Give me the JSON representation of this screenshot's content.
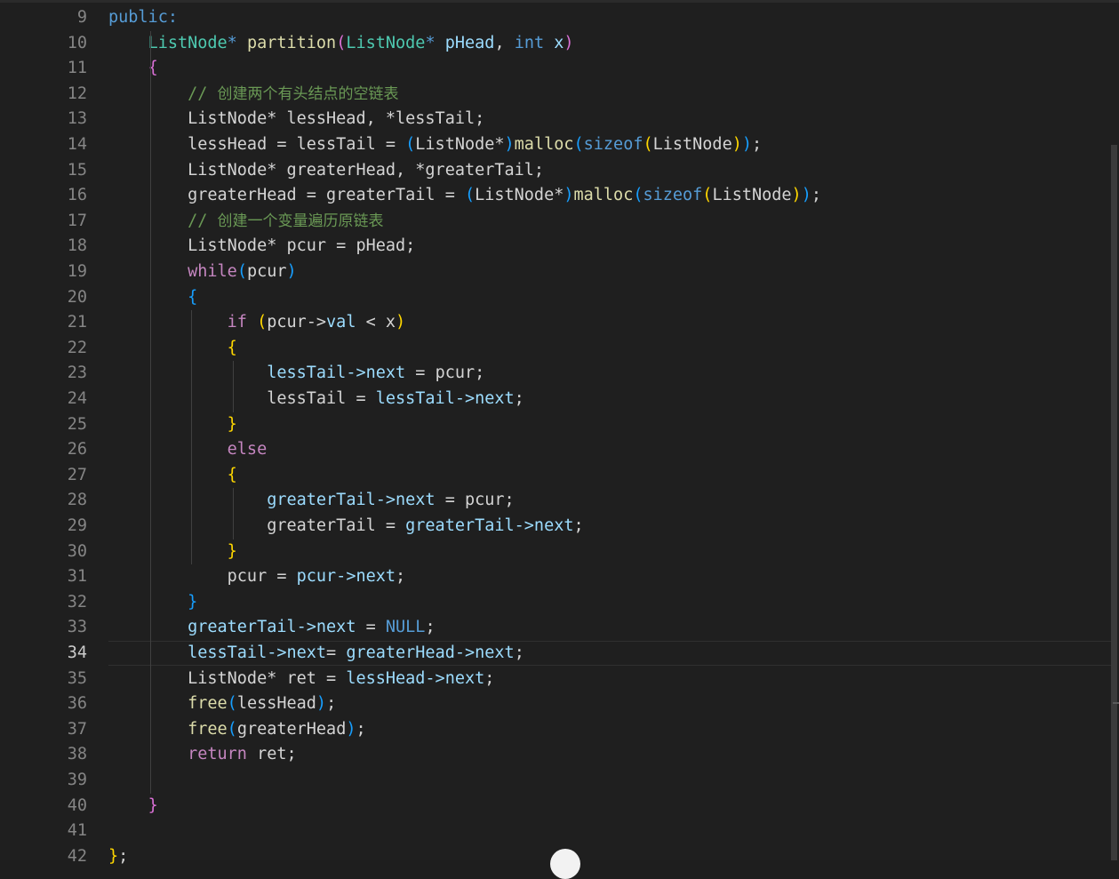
{
  "editor": {
    "active_line": "34",
    "lines": [
      {
        "n": "9",
        "tokens": [
          {
            "t": "public:",
            "c": "kw"
          }
        ]
      },
      {
        "n": "10",
        "tokens": [
          {
            "t": "    "
          },
          {
            "t": "ListNode",
            "c": "ty"
          },
          {
            "t": "* ",
            "c": "kw"
          },
          {
            "t": "partition",
            "c": "fn"
          },
          {
            "t": "(",
            "c": "p2"
          },
          {
            "t": "ListNode",
            "c": "ty"
          },
          {
            "t": "* ",
            "c": "kw"
          },
          {
            "t": "pHead",
            "c": "var"
          },
          {
            "t": ", "
          },
          {
            "t": "int",
            "c": "kw"
          },
          {
            "t": " "
          },
          {
            "t": "x",
            "c": "var"
          },
          {
            "t": ")",
            "c": "p2"
          }
        ]
      },
      {
        "n": "11",
        "tokens": [
          {
            "t": "    "
          },
          {
            "t": "{",
            "c": "p2"
          }
        ]
      },
      {
        "n": "12",
        "tokens": [
          {
            "t": "        "
          },
          {
            "t": "// ",
            "c": "cm"
          },
          {
            "t": "创建两个有头结点的空链表",
            "c": "cm ch"
          }
        ]
      },
      {
        "n": "13",
        "tokens": [
          {
            "t": "        ListNode* lessHead, *lessTail;"
          }
        ]
      },
      {
        "n": "14",
        "tokens": [
          {
            "t": "        lessHead = lessTail = "
          },
          {
            "t": "(",
            "c": "p3"
          },
          {
            "t": "ListNode*"
          },
          {
            "t": ")",
            "c": "p3"
          },
          {
            "t": "malloc",
            "c": "fn"
          },
          {
            "t": "(",
            "c": "p3"
          },
          {
            "t": "sizeof",
            "c": "kw"
          },
          {
            "t": "(",
            "c": "p1"
          },
          {
            "t": "ListNode"
          },
          {
            "t": ")",
            "c": "p1"
          },
          {
            "t": ")",
            "c": "p3"
          },
          {
            "t": ";"
          }
        ]
      },
      {
        "n": "15",
        "tokens": [
          {
            "t": "        ListNode* greaterHead, *greaterTail;"
          }
        ]
      },
      {
        "n": "16",
        "tokens": [
          {
            "t": "        greaterHead = greaterTail = "
          },
          {
            "t": "(",
            "c": "p3"
          },
          {
            "t": "ListNode*"
          },
          {
            "t": ")",
            "c": "p3"
          },
          {
            "t": "malloc",
            "c": "fn"
          },
          {
            "t": "(",
            "c": "p3"
          },
          {
            "t": "sizeof",
            "c": "kw"
          },
          {
            "t": "(",
            "c": "p1"
          },
          {
            "t": "ListNode"
          },
          {
            "t": ")",
            "c": "p1"
          },
          {
            "t": ")",
            "c": "p3"
          },
          {
            "t": ";"
          }
        ]
      },
      {
        "n": "17",
        "tokens": [
          {
            "t": "        "
          },
          {
            "t": "// ",
            "c": "cm"
          },
          {
            "t": "创建一个变量遍历原链表",
            "c": "cm ch"
          }
        ]
      },
      {
        "n": "18",
        "tokens": [
          {
            "t": "        ListNode* pcur = pHead;"
          }
        ]
      },
      {
        "n": "19",
        "tokens": [
          {
            "t": "        "
          },
          {
            "t": "while",
            "c": "ctrl"
          },
          {
            "t": "(",
            "c": "p3"
          },
          {
            "t": "pcur"
          },
          {
            "t": ")",
            "c": "p3"
          }
        ]
      },
      {
        "n": "20",
        "tokens": [
          {
            "t": "        "
          },
          {
            "t": "{",
            "c": "p3"
          }
        ]
      },
      {
        "n": "21",
        "tokens": [
          {
            "t": "            "
          },
          {
            "t": "if",
            "c": "ctrl"
          },
          {
            "t": " "
          },
          {
            "t": "(",
            "c": "p1"
          },
          {
            "t": "pcur->"
          },
          {
            "t": "val",
            "c": "var"
          },
          {
            "t": " < x"
          },
          {
            "t": ")",
            "c": "p1"
          }
        ]
      },
      {
        "n": "22",
        "tokens": [
          {
            "t": "            "
          },
          {
            "t": "{",
            "c": "p1"
          }
        ]
      },
      {
        "n": "23",
        "tokens": [
          {
            "t": "                "
          },
          {
            "t": "lessTail->next",
            "c": "var"
          },
          {
            "t": " = pcur;"
          }
        ]
      },
      {
        "n": "24",
        "tokens": [
          {
            "t": "                lessTail = "
          },
          {
            "t": "lessTail->next",
            "c": "var"
          },
          {
            "t": ";"
          }
        ]
      },
      {
        "n": "25",
        "tokens": [
          {
            "t": "            "
          },
          {
            "t": "}",
            "c": "p1"
          }
        ]
      },
      {
        "n": "26",
        "tokens": [
          {
            "t": "            "
          },
          {
            "t": "else",
            "c": "ctrl"
          }
        ]
      },
      {
        "n": "27",
        "tokens": [
          {
            "t": "            "
          },
          {
            "t": "{",
            "c": "p1"
          }
        ]
      },
      {
        "n": "28",
        "tokens": [
          {
            "t": "                "
          },
          {
            "t": "greaterTail->next",
            "c": "var"
          },
          {
            "t": " = pcur;"
          }
        ]
      },
      {
        "n": "29",
        "tokens": [
          {
            "t": "                greaterTail = "
          },
          {
            "t": "greaterTail->next",
            "c": "var"
          },
          {
            "t": ";"
          }
        ]
      },
      {
        "n": "30",
        "tokens": [
          {
            "t": "            "
          },
          {
            "t": "}",
            "c": "p1"
          }
        ]
      },
      {
        "n": "31",
        "tokens": [
          {
            "t": "            pcur = "
          },
          {
            "t": "pcur->next",
            "c": "var"
          },
          {
            "t": ";"
          }
        ]
      },
      {
        "n": "32",
        "tokens": [
          {
            "t": "        "
          },
          {
            "t": "}",
            "c": "p3"
          }
        ]
      },
      {
        "n": "33",
        "tokens": [
          {
            "t": "        "
          },
          {
            "t": "greaterTail->next",
            "c": "var"
          },
          {
            "t": " = "
          },
          {
            "t": "NULL",
            "c": "kw"
          },
          {
            "t": ";"
          }
        ]
      },
      {
        "n": "34",
        "tokens": [
          {
            "t": "        "
          },
          {
            "t": "lessTail->next",
            "c": "var"
          },
          {
            "t": "= "
          },
          {
            "t": "greaterHead->next",
            "c": "var"
          },
          {
            "t": ";"
          }
        ]
      },
      {
        "n": "35",
        "tokens": [
          {
            "t": "        ListNode* ret = "
          },
          {
            "t": "lessHead->next",
            "c": "var"
          },
          {
            "t": ";"
          }
        ]
      },
      {
        "n": "36",
        "tokens": [
          {
            "t": "        "
          },
          {
            "t": "free",
            "c": "fn"
          },
          {
            "t": "(",
            "c": "p3"
          },
          {
            "t": "lessHead"
          },
          {
            "t": ")",
            "c": "p3"
          },
          {
            "t": ";"
          }
        ]
      },
      {
        "n": "37",
        "tokens": [
          {
            "t": "        "
          },
          {
            "t": "free",
            "c": "fn"
          },
          {
            "t": "(",
            "c": "p3"
          },
          {
            "t": "greaterHead"
          },
          {
            "t": ")",
            "c": "p3"
          },
          {
            "t": ";"
          }
        ]
      },
      {
        "n": "38",
        "tokens": [
          {
            "t": "        "
          },
          {
            "t": "return",
            "c": "ctrl"
          },
          {
            "t": " ret;"
          }
        ]
      },
      {
        "n": "39",
        "tokens": []
      },
      {
        "n": "40",
        "tokens": [
          {
            "t": "    "
          },
          {
            "t": "}",
            "c": "p2"
          }
        ]
      },
      {
        "n": "41",
        "tokens": []
      },
      {
        "n": "42",
        "tokens": [
          {
            "t": "}",
            "c": "p1"
          },
          {
            "t": ";"
          }
        ]
      }
    ]
  }
}
